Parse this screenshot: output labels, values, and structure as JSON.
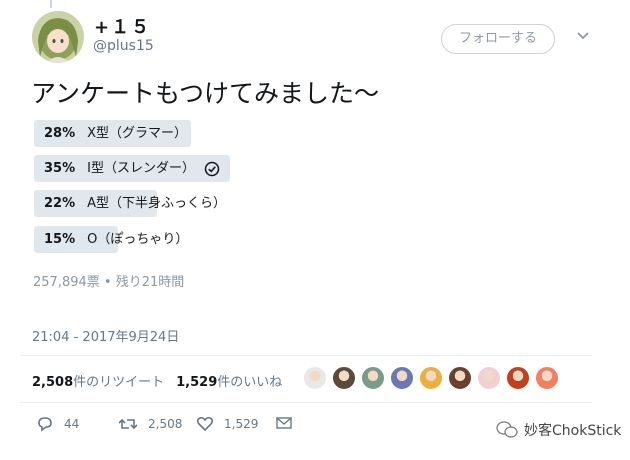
{
  "tweet": {
    "display_name": "+１５",
    "handle": "@plus15",
    "follow_label": "フォローする",
    "text": "アンケートもつけてみました～",
    "timestamp": "21:04 - 2017年9月24日",
    "retweets_label": "件のリツイート",
    "retweets_count": "2,508",
    "likes_label": "件のいいね",
    "likes_count": "1,529"
  },
  "poll": {
    "options": [
      {
        "percent": "28%",
        "label": "X型（グラマー）",
        "value": 28,
        "selected": false
      },
      {
        "percent": "35%",
        "label": "I型（スレンダー）",
        "value": 35,
        "selected": true
      },
      {
        "percent": "22%",
        "label": "A型（下半身ふっくら）",
        "value": 22,
        "selected": false
      },
      {
        "percent": "15%",
        "label": "O（ぽっちゃり）",
        "value": 15,
        "selected": false
      }
    ],
    "meta": "257,894票 • 残り21時間"
  },
  "actions": {
    "reply_count": "44",
    "retweet_count": "2,508",
    "like_count": "1,529"
  },
  "watermark": "妙客ChokStick",
  "likers": [
    "#e8e8e8",
    "#5a4a3a",
    "#7a9a8a",
    "#6a7ab0",
    "#e8b040",
    "#6a4030",
    "#f0d0d0",
    "#c04020",
    "#f08060"
  ]
}
